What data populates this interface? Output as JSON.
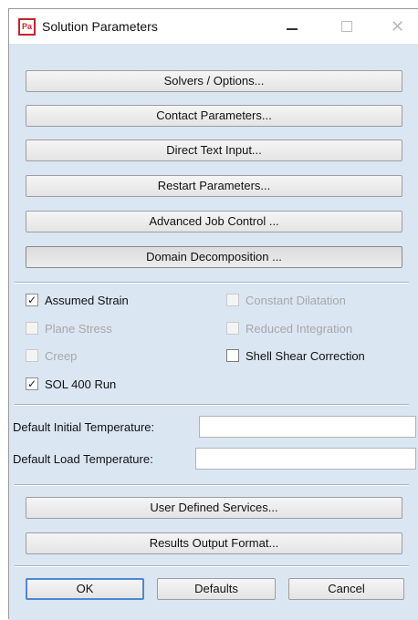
{
  "window": {
    "title": "Solution Parameters",
    "app_icon_text": "Pa"
  },
  "top_buttons": [
    "Solvers / Options...",
    "Contact Parameters...",
    "Direct Text Input...",
    "Restart Parameters...",
    "Advanced Job Control ...",
    "Domain Decomposition ..."
  ],
  "options": {
    "assumed_strain": {
      "label": "Assumed Strain",
      "checked": true,
      "enabled": true
    },
    "constant_dilatation": {
      "label": "Constant Dilatation",
      "checked": false,
      "enabled": false
    },
    "plane_stress": {
      "label": "Plane Stress",
      "checked": false,
      "enabled": false
    },
    "reduced_integration": {
      "label": "Reduced Integration",
      "checked": false,
      "enabled": false
    },
    "creep": {
      "label": "Creep",
      "checked": false,
      "enabled": false
    },
    "shell_shear_correction": {
      "label": "Shell Shear Correction",
      "checked": false,
      "enabled": true
    },
    "sol400_run": {
      "label": "SOL 400 Run",
      "checked": true,
      "enabled": true
    }
  },
  "fields": {
    "initial_temp": {
      "label": "Default Initial Temperature:",
      "value": ""
    },
    "load_temp": {
      "label": "Default Load Temperature:",
      "value": ""
    }
  },
  "bottom_buttons": [
    "User Defined Services...",
    "Results Output Format..."
  ],
  "dialog_buttons": {
    "ok": "OK",
    "defaults": "Defaults",
    "cancel": "Cancel"
  }
}
